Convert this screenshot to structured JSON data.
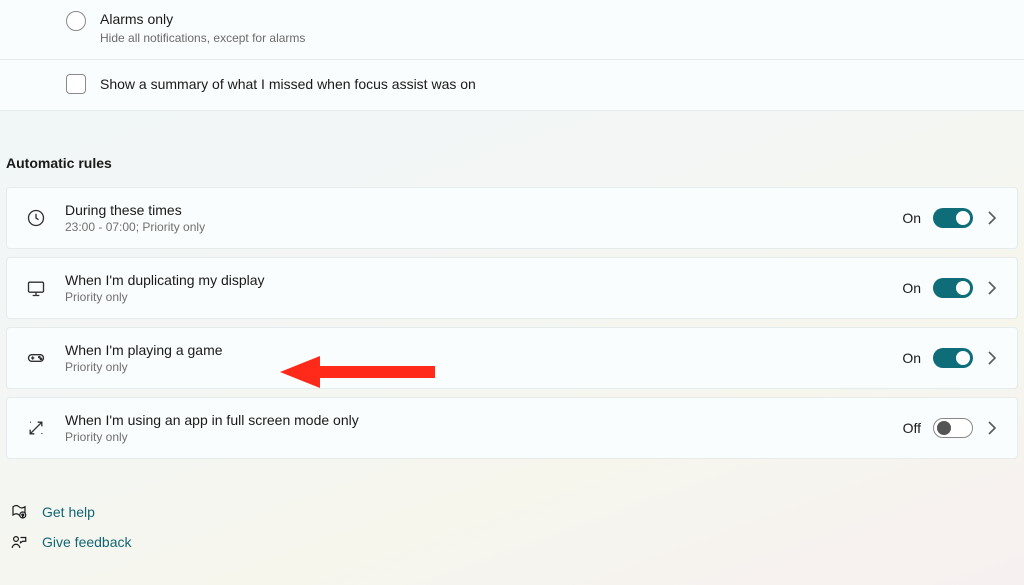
{
  "focus_options": {
    "alarms_only": {
      "title": "Alarms only",
      "desc": "Hide all notifications, except for alarms"
    },
    "summary_checkbox_label": "Show a summary of what I missed when focus assist was on"
  },
  "section_heading": "Automatic rules",
  "toggle_labels": {
    "on": "On",
    "off": "Off"
  },
  "rules": [
    {
      "title": "During these times",
      "desc": "23:00 - 07:00; Priority only",
      "state": "on"
    },
    {
      "title": "When I'm duplicating my display",
      "desc": "Priority only",
      "state": "on"
    },
    {
      "title": "When I'm playing a game",
      "desc": "Priority only",
      "state": "on"
    },
    {
      "title": "When I'm using an app in full screen mode only",
      "desc": "Priority only",
      "state": "off"
    }
  ],
  "links": {
    "help": "Get help",
    "feedback": "Give feedback"
  }
}
